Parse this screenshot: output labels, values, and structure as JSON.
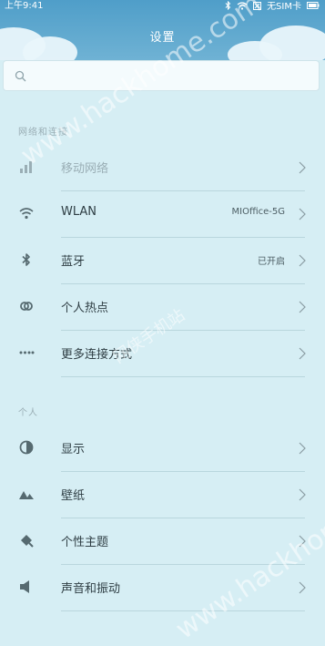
{
  "statusbar": {
    "time": "上午9:41",
    "carrier": "无SIM卡"
  },
  "header": {
    "title": "设置"
  },
  "search": {
    "placeholder": ""
  },
  "sections": {
    "network": "网络和连接",
    "personal": "个人"
  },
  "network_items": [
    {
      "label": "移动网络",
      "value": "",
      "icon": "signal-icon",
      "dimmed": true
    },
    {
      "label": "WLAN",
      "value": "MIOffice-5G",
      "icon": "wifi-icon"
    },
    {
      "label": "蓝牙",
      "value": "已开启",
      "icon": "bluetooth-icon"
    },
    {
      "label": "个人热点",
      "value": "",
      "icon": "hotspot-icon"
    },
    {
      "label": "更多连接方式",
      "value": "",
      "icon": "more-dots-icon"
    }
  ],
  "personal_items": [
    {
      "label": "显示",
      "icon": "display-icon"
    },
    {
      "label": "壁纸",
      "icon": "wallpaper-icon"
    },
    {
      "label": "个性主题",
      "icon": "theme-brush-icon"
    },
    {
      "label": "声音和振动",
      "icon": "speaker-icon"
    }
  ],
  "watermark": {
    "text1": "www.hackhome.com",
    "text2": "www.hackhome.com",
    "text3": "网侠手机站"
  }
}
